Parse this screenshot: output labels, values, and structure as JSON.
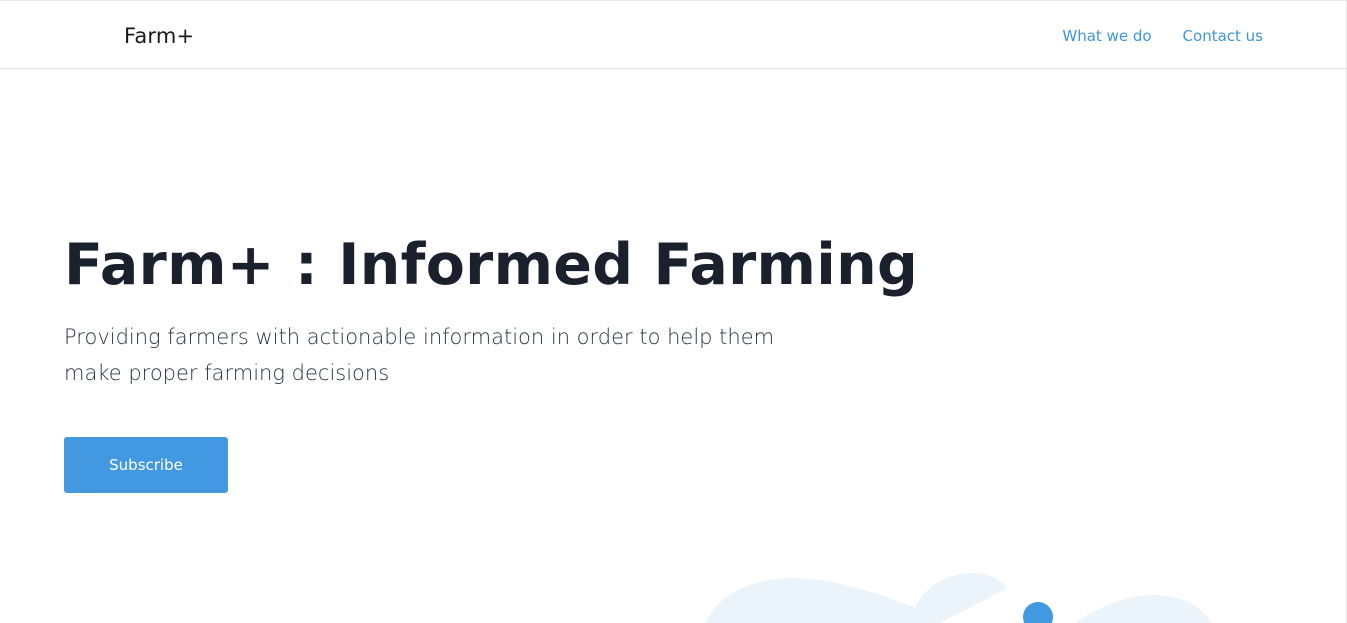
{
  "navbar": {
    "brand": "Farm+",
    "links": [
      {
        "label": "What we do"
      },
      {
        "label": "Contact us"
      }
    ]
  },
  "hero": {
    "title": "Farm+ : Informed Farming",
    "subtitle": "Providing farmers with actionable information in order to help them make proper farming decisions",
    "cta_label": "Subscribe"
  },
  "colors": {
    "accent": "#4299e1",
    "link": "#3f95db",
    "heading": "#1a202c",
    "illustration_fill": "#ebf4fb"
  }
}
